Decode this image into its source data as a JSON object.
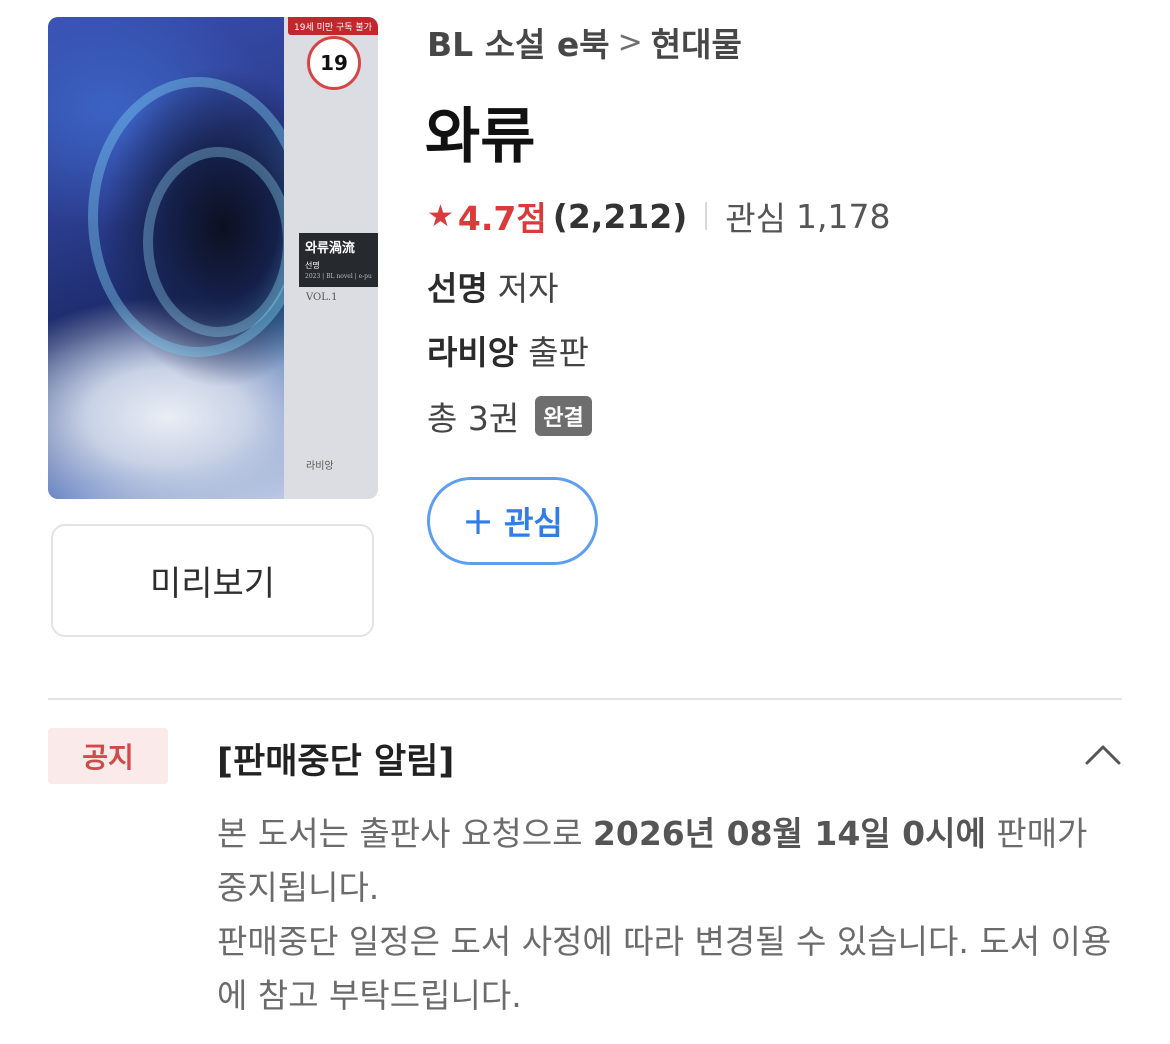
{
  "cover": {
    "age_ribbon": "19세 미만 구독 불가",
    "age_badge": "19",
    "label_title": "와류渦流",
    "label_author": "선명",
    "label_meta": "2023 | BL novel | e-pub",
    "volume": "VOL.1",
    "publisher_mark": "라비앙"
  },
  "preview_button": "미리보기",
  "breadcrumb": {
    "category": "BL 소설 e북",
    "separator": ">",
    "subcategory": "현대물"
  },
  "title": "와류",
  "rating": {
    "star_icon": "star-icon",
    "score": "4.7점",
    "count": "(2,212)",
    "interest_label": "관심",
    "interest_count": "1,178"
  },
  "author": {
    "name": "선명",
    "role": "저자"
  },
  "publisher": {
    "name": "라비앙",
    "role": "출판"
  },
  "volumes": {
    "text": "총 3권",
    "status_badge": "완결"
  },
  "interest_button": {
    "icon": "+",
    "label": "관심"
  },
  "notice": {
    "badge": "공지",
    "title": "[판매중단 알림]",
    "body_part1": "본 도서는 출판사 요청으로 ",
    "body_bold": "2026년 08월 14일 0시에",
    "body_part2": " 판매가 중지됩니다.",
    "body_line2": "판매중단 일정은 도서 사정에 따라 변경될 수 있습니다. 도서 이용에 참고 부탁드립니다."
  },
  "colors": {
    "accent_red": "#d93a3a",
    "accent_blue": "#2f7de6",
    "badge_gray": "#6e6e6e"
  }
}
